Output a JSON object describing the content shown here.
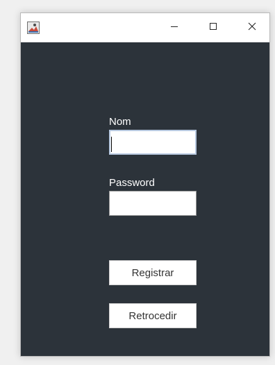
{
  "window": {
    "controls": {
      "minimize": "minimize-icon",
      "maximize": "maximize-icon",
      "close": "close-icon"
    },
    "background_color": "#2c333a"
  },
  "form": {
    "nom_label": "Nom",
    "nom_value": "",
    "password_label": "Password",
    "password_value": "",
    "register_button": "Registrar",
    "back_button": "Retrocedir"
  }
}
